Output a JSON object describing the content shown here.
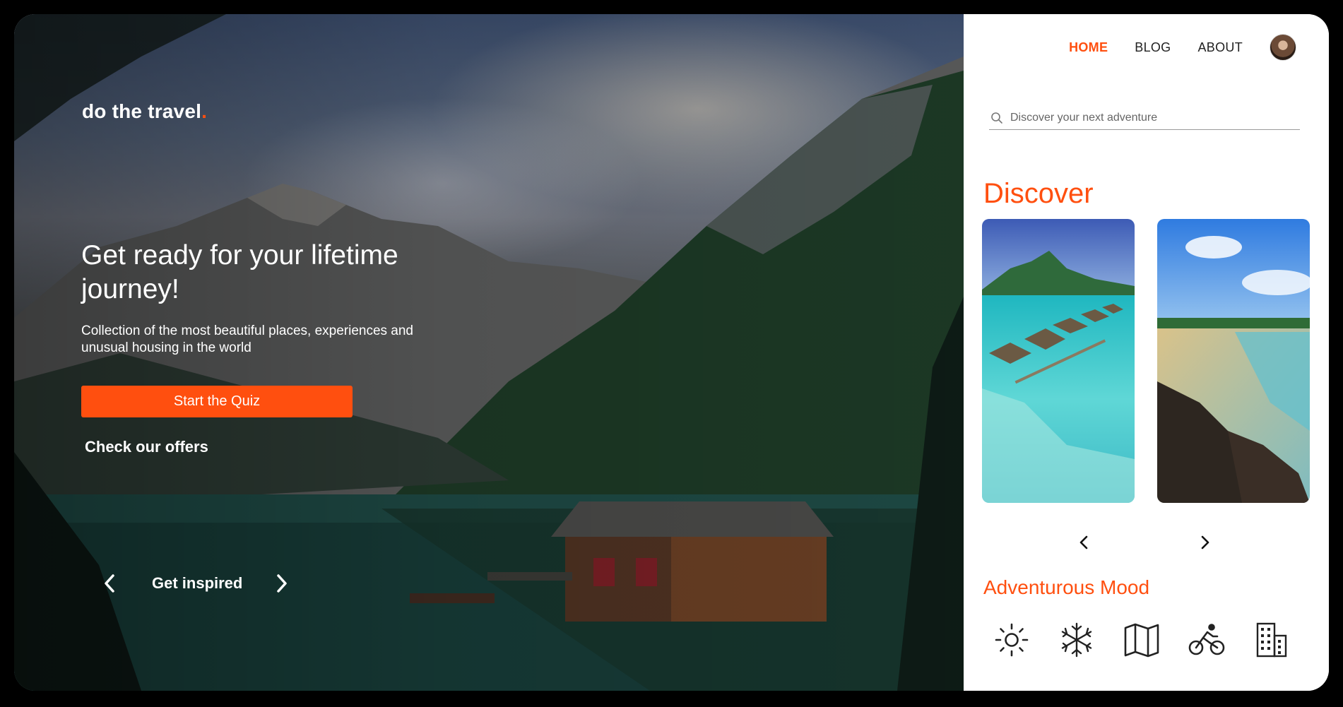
{
  "hero": {
    "brand": "do the travel",
    "brand_dot": ".",
    "headline": "Get ready for your lifetime journey!",
    "subline": "Collection of the most beautiful places, experiences and unusual housing in the world",
    "cta_label": "Start the Quiz",
    "offers_label": "Check our offers",
    "inspired_label": "Get inspired"
  },
  "nav": {
    "items": [
      {
        "label": "HOME",
        "active": true
      },
      {
        "label": "BLOG",
        "active": false
      },
      {
        "label": "ABOUT",
        "active": false
      }
    ]
  },
  "search": {
    "placeholder": "Discover your next adventure"
  },
  "discover": {
    "title": "Discover"
  },
  "mood": {
    "title": "Adventurous Mood",
    "icons": [
      "sun-icon",
      "snowflake-icon",
      "map-icon",
      "bicycle-icon",
      "buildings-icon"
    ]
  },
  "colors": {
    "accent": "#ff4f0f"
  }
}
